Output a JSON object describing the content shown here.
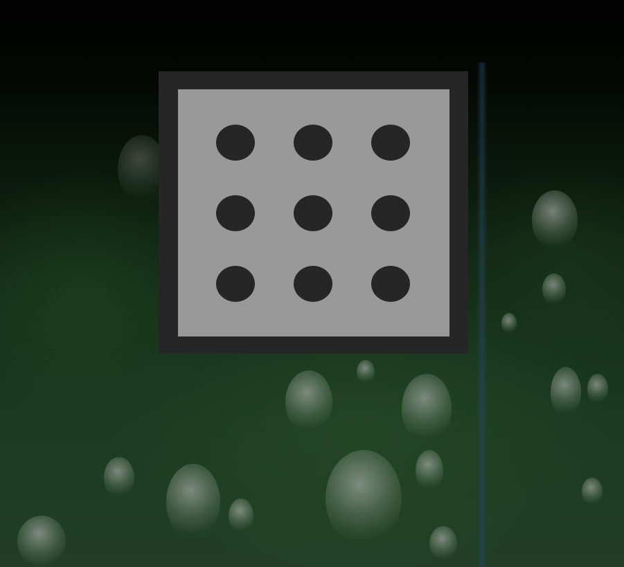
{
  "screen": {
    "type": "lock-screen",
    "wallpaper": "green-leaf-with-water-drops"
  },
  "unlock_widget": {
    "icon": "pattern-unlock-icon",
    "grid": [
      3,
      3
    ],
    "colors": {
      "frame": "#262626",
      "panel": "#999999",
      "dot": "#262626"
    }
  }
}
